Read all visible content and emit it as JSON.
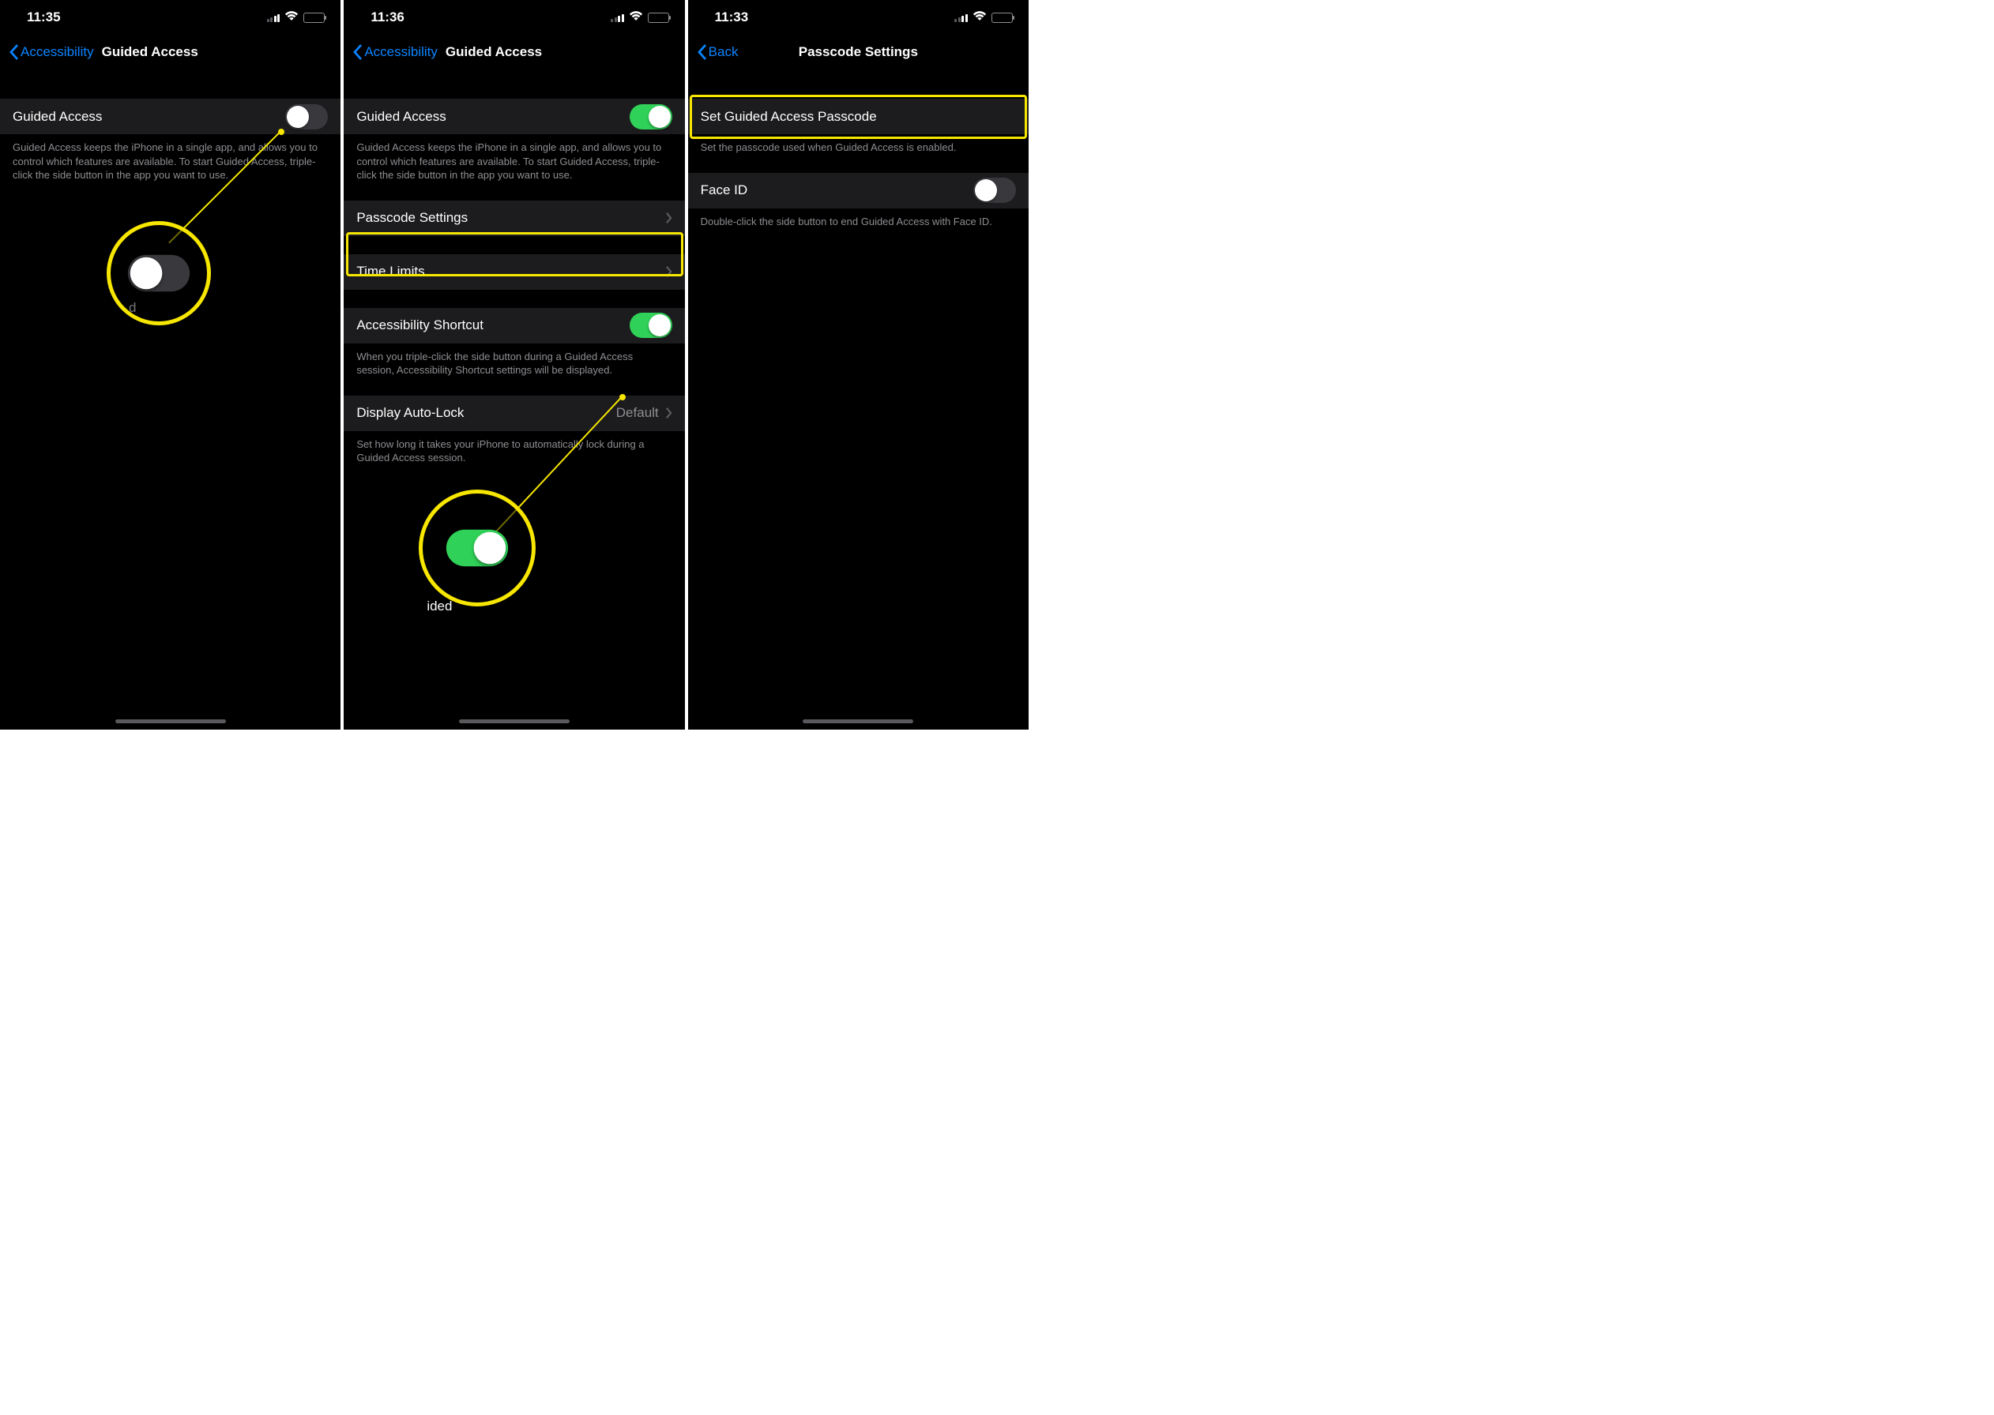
{
  "screen1": {
    "time": "11:35",
    "back": "Accessibility",
    "title": "Guided Access",
    "row_ga": "Guided Access",
    "ga_on": false,
    "footer_ga": "Guided Access keeps the iPhone in a single app, and allows you to control which features are available. To start Guided Access, triple-click the side button in the app you want to use.",
    "zoom_caption": "d"
  },
  "screen2": {
    "time": "11:36",
    "back": "Accessibility",
    "title": "Guided Access",
    "row_ga": "Guided Access",
    "ga_on": true,
    "footer_ga": "Guided Access keeps the iPhone in a single app, and allows you to control which features are available. To start Guided Access, triple-click the side button in the app you want to use.",
    "row_passcode": "Passcode Settings",
    "row_timelimits": "Time Limits",
    "row_shortcut": "Accessibility Shortcut",
    "shortcut_on": true,
    "footer_shortcut": "When you triple-click the side button during a Guided Access session, Accessibility Shortcut settings will be displayed.",
    "row_display_label": "Display Auto-Lock",
    "row_display_value": "Default",
    "footer_display": "Set how long it takes your iPhone to automatically lock during a Guided Access session.",
    "zoom_caption": "ided"
  },
  "screen3": {
    "time": "11:33",
    "back": "Back",
    "title": "Passcode Settings",
    "row_set": "Set Guided Access Passcode",
    "footer_set": "Set the passcode used when Guided Access is enabled.",
    "row_faceid": "Face ID",
    "faceid_on": false,
    "footer_faceid": "Double-click the side button to end Guided Access with Face ID."
  }
}
